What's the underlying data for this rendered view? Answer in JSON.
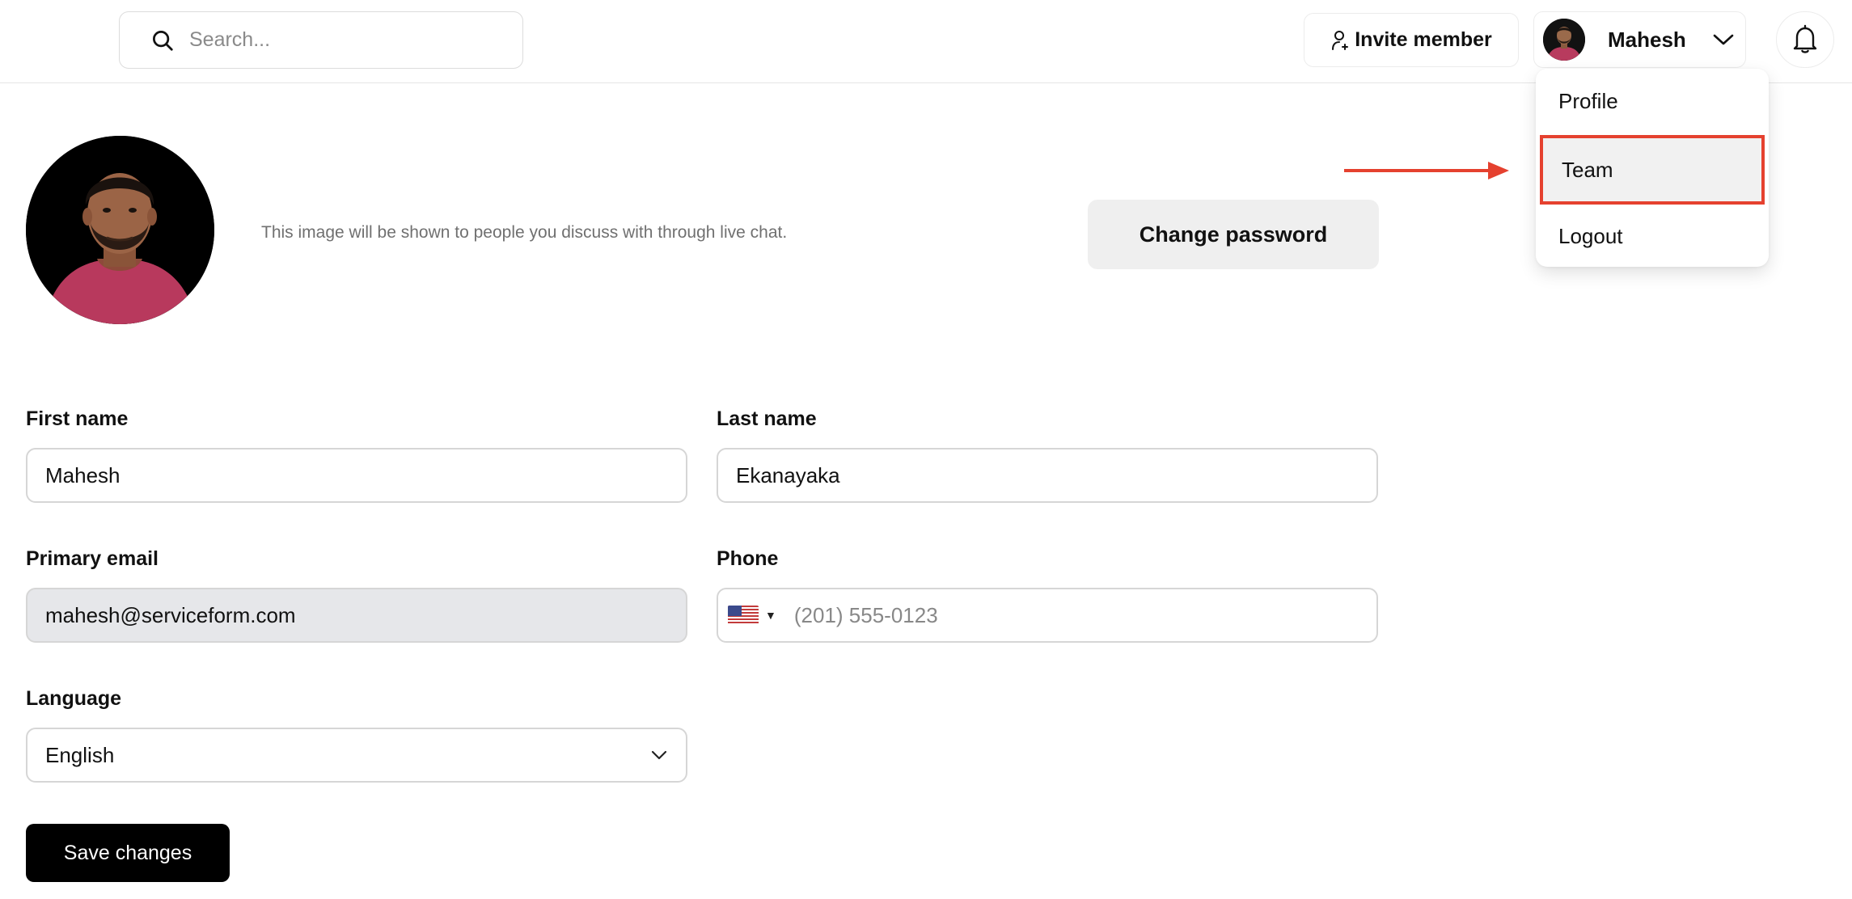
{
  "header": {
    "search_placeholder": "Search...",
    "invite_label": "Invite member",
    "user_name": "Mahesh"
  },
  "user_menu": {
    "items": [
      {
        "label": "Profile"
      },
      {
        "label": "Team"
      },
      {
        "label": "Logout"
      }
    ],
    "highlight_color": "#e5412f"
  },
  "profile": {
    "avatar_hint": "This image will be shown to people you discuss with through live chat.",
    "change_password_label": "Change password"
  },
  "form": {
    "first_name": {
      "label": "First name",
      "value": "Mahesh"
    },
    "last_name": {
      "label": "Last name",
      "value": "Ekanayaka"
    },
    "email": {
      "label": "Primary email",
      "value": "mahesh@serviceform.com"
    },
    "phone": {
      "label": "Phone",
      "placeholder": "(201) 555-0123",
      "country": "us-flag-icon"
    },
    "language": {
      "label": "Language",
      "value": "English"
    },
    "save_label": "Save changes"
  }
}
